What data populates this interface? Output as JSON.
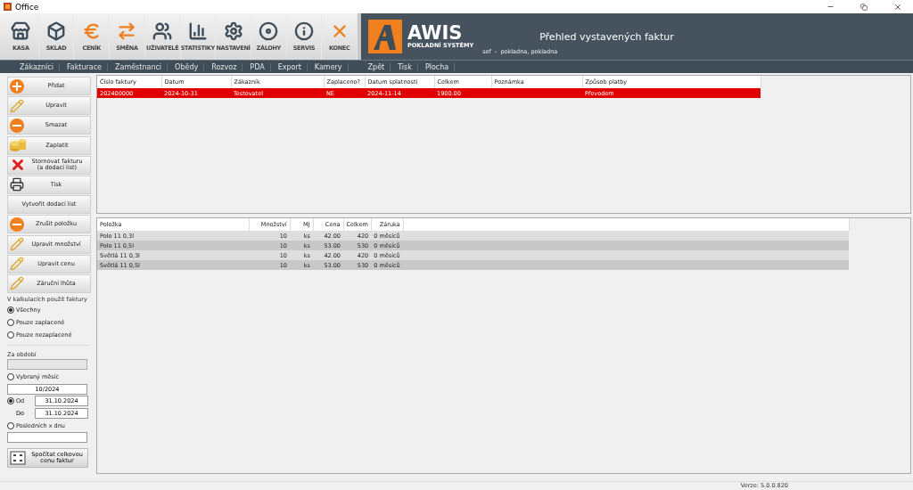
{
  "window": {
    "title": "Office"
  },
  "toolbar": [
    {
      "label": "KASA"
    },
    {
      "label": "SKLAD"
    },
    {
      "label": "CENÍK"
    },
    {
      "label": "SMĚNA"
    },
    {
      "label": "UŽIVATELÉ"
    },
    {
      "label": "STATISTIKY"
    },
    {
      "label": "NASTAVENÍ"
    },
    {
      "label": "ZÁLOHY"
    },
    {
      "label": "SERVIS"
    },
    {
      "label": "KONEC"
    }
  ],
  "brand": {
    "name": "AWIS",
    "tagline": "POKLADNÍ SYSTÉMY"
  },
  "header": {
    "title": "Přehled vystavených faktur",
    "user": "sef  -  pokladna, pokladna"
  },
  "menu": {
    "left": [
      "Zákazníci",
      "Fakturace",
      "Zaměstnanci",
      "Obědy",
      "Rozvoz",
      "PDA",
      "Export",
      "Kamery"
    ],
    "right": [
      "Zpět",
      "Tisk",
      "Plocha"
    ]
  },
  "actions": [
    {
      "label": "Přidat",
      "kind": "icon"
    },
    {
      "label": "Upravit",
      "kind": "icon"
    },
    {
      "label": "Smazat",
      "kind": "icon"
    },
    {
      "label": "Zaplatit",
      "kind": "icon"
    },
    {
      "label": "Stornovat fakturu\n(a dodací list)",
      "kind": "icon"
    },
    {
      "label": "Tisk",
      "kind": "icon"
    },
    {
      "label": "Vytvořit dodací list",
      "kind": "plain"
    },
    {
      "label": "Zrušit položku",
      "kind": "icon"
    },
    {
      "label": "Upravit množství",
      "kind": "icon"
    },
    {
      "label": "Upravit cenu",
      "kind": "icon"
    },
    {
      "label": "Záruční lhůta",
      "kind": "icon"
    }
  ],
  "calc": {
    "label": "V kalkulacích použít faktury",
    "options": [
      {
        "label": "Všechny",
        "selected": true
      },
      {
        "label": "Pouze zaplacené",
        "selected": false
      },
      {
        "label": "Pouze nezaplacené",
        "selected": false
      }
    ]
  },
  "period": {
    "label": "Za období",
    "options": [
      {
        "kind": "month",
        "label": "Vybraný měsíc",
        "selected": false,
        "value": "10/2024"
      },
      {
        "kind": "range",
        "label": "Od",
        "selected": true,
        "value": "31.10.2024",
        "to_label": "Do",
        "to_value": "31.10.2024"
      },
      {
        "kind": "days",
        "label": "Posledních x dnu",
        "selected": false
      }
    ],
    "button": "Spočítat celkovou\ncenu faktur"
  },
  "invoices": {
    "columns": [
      "Číslo faktury",
      "Datum",
      "Zákazník",
      "Zaplaceno?",
      "Datum splatnosti",
      "Celkem",
      "Poznámka",
      "Způsob platby"
    ],
    "rows": [
      {
        "cells": [
          "202400000",
          "2024-10-31",
          "Testovatel",
          "NE",
          "2024-11-14",
          "1900.00",
          "",
          "Převodem"
        ],
        "selected": true
      }
    ]
  },
  "items": {
    "columns": [
      "Položka",
      "Množství",
      "MJ",
      "Cena",
      "Celkem",
      "Záruka"
    ],
    "rows": [
      {
        "cells": [
          "Polo 11 0,3l",
          "10",
          "ks",
          "42.00",
          "420",
          "0 měsíců"
        ]
      },
      {
        "cells": [
          "Polo 11 0,5l",
          "10",
          "ks",
          "53.00",
          "530",
          "0 měsíců"
        ]
      },
      {
        "cells": [
          "Světlá 11 0,3l",
          "10",
          "ks",
          "42.00",
          "420",
          "0 měsíců"
        ]
      },
      {
        "cells": [
          "Světlá 11 0,5l",
          "10",
          "ks",
          "53.00",
          "530",
          "0 měsíců"
        ]
      }
    ]
  },
  "status_bar": {
    "version": "Verze: 5.0.0.820"
  }
}
